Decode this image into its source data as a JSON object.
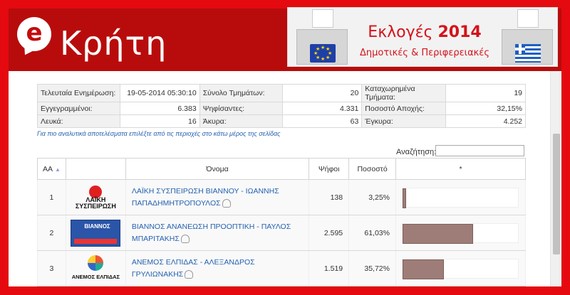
{
  "header": {
    "logo_letter": "e",
    "site_title": "Κρήτη",
    "banner_title_prefix": "Εκλογές",
    "banner_title_year": "2014",
    "banner_subtitle": "Δημοτικές & Περιφερειακές"
  },
  "summary": {
    "row1": {
      "last_update_label": "Τελευταία Ενημέρωση:",
      "last_update_value": "19-05-2014 05:30:10",
      "sections_total_label": "Σύνολο Τμημάτων:",
      "sections_total_value": "20",
      "sections_counted_label": "Καταχωρημένα Τμήματα:",
      "sections_counted_value": "19"
    },
    "row2": {
      "registered_label": "Εγγεγραμμένοι:",
      "registered_value": "6.383",
      "voted_label": "Ψηφίσαντες:",
      "voted_value": "4.331",
      "abstention_label": "Ποσοστό Αποχής:",
      "abstention_value": "32,15%"
    },
    "row3": {
      "blank_label": "Λευκά:",
      "blank_value": "16",
      "invalid_label": "Άκυρα:",
      "invalid_value": "63",
      "valid_label": "Έγκυρα:",
      "valid_value": "4.252"
    }
  },
  "info_note": "Για πιο αναλυτικά αποτελέσματα επιλέξτε από τις περιοχές στο κάτω μέρος της σελίδας",
  "search": {
    "label": "Αναζήτηση:",
    "value": ""
  },
  "table": {
    "headers": {
      "rank": "ΑΑ",
      "logo": "",
      "name": "Όνομα",
      "votes": "Ψήφοι",
      "percent": "Ποσοστό",
      "bar": "*"
    },
    "rows": [
      {
        "rank": "1",
        "logo_text": "ΛΑΪΚΗ ΣΥΣΠΕΙΡΩΣΗ",
        "name": "ΛΑΪΚΗ ΣΥΣΠΕΙΡΩΣΗ ΒΙΑΝΝΟΥ - ΙΩΑΝΝΗΣ ΠΑΠΑΔΗΜΗΤΡΟΠΟΥΛΟΣ",
        "votes": "138",
        "percent": "3,25%",
        "share": 3.25
      },
      {
        "rank": "2",
        "logo_text": "ΒΙΑΝΝΟΣ",
        "name": "ΒΙΑΝΝΟΣ ΑΝΑΝΕΩΣΗ ΠΡΟΟΠΤΙΚΗ - ΠΑΥΛΟΣ ΜΠΑΡΙΤΑΚΗΣ",
        "votes": "2.595",
        "percent": "61,03%",
        "share": 61.03
      },
      {
        "rank": "3",
        "logo_text": "ΑΝΕΜΟΣ ΕΛΠΙΔΑΣ",
        "name": "ΑΝΕΜΟΣ ΕΛΠΙΔΑΣ - ΑΛΕΞΑΝΔΡΟΣ ΓΡΥΛΙΩΝΑΚΗΣ",
        "votes": "1.519",
        "percent": "35,72%",
        "share": 35.72
      }
    ]
  },
  "colors": {
    "brand_red": "#e40a0f",
    "bar_fill": "#9e7d78",
    "link_blue": "#2461b0"
  }
}
